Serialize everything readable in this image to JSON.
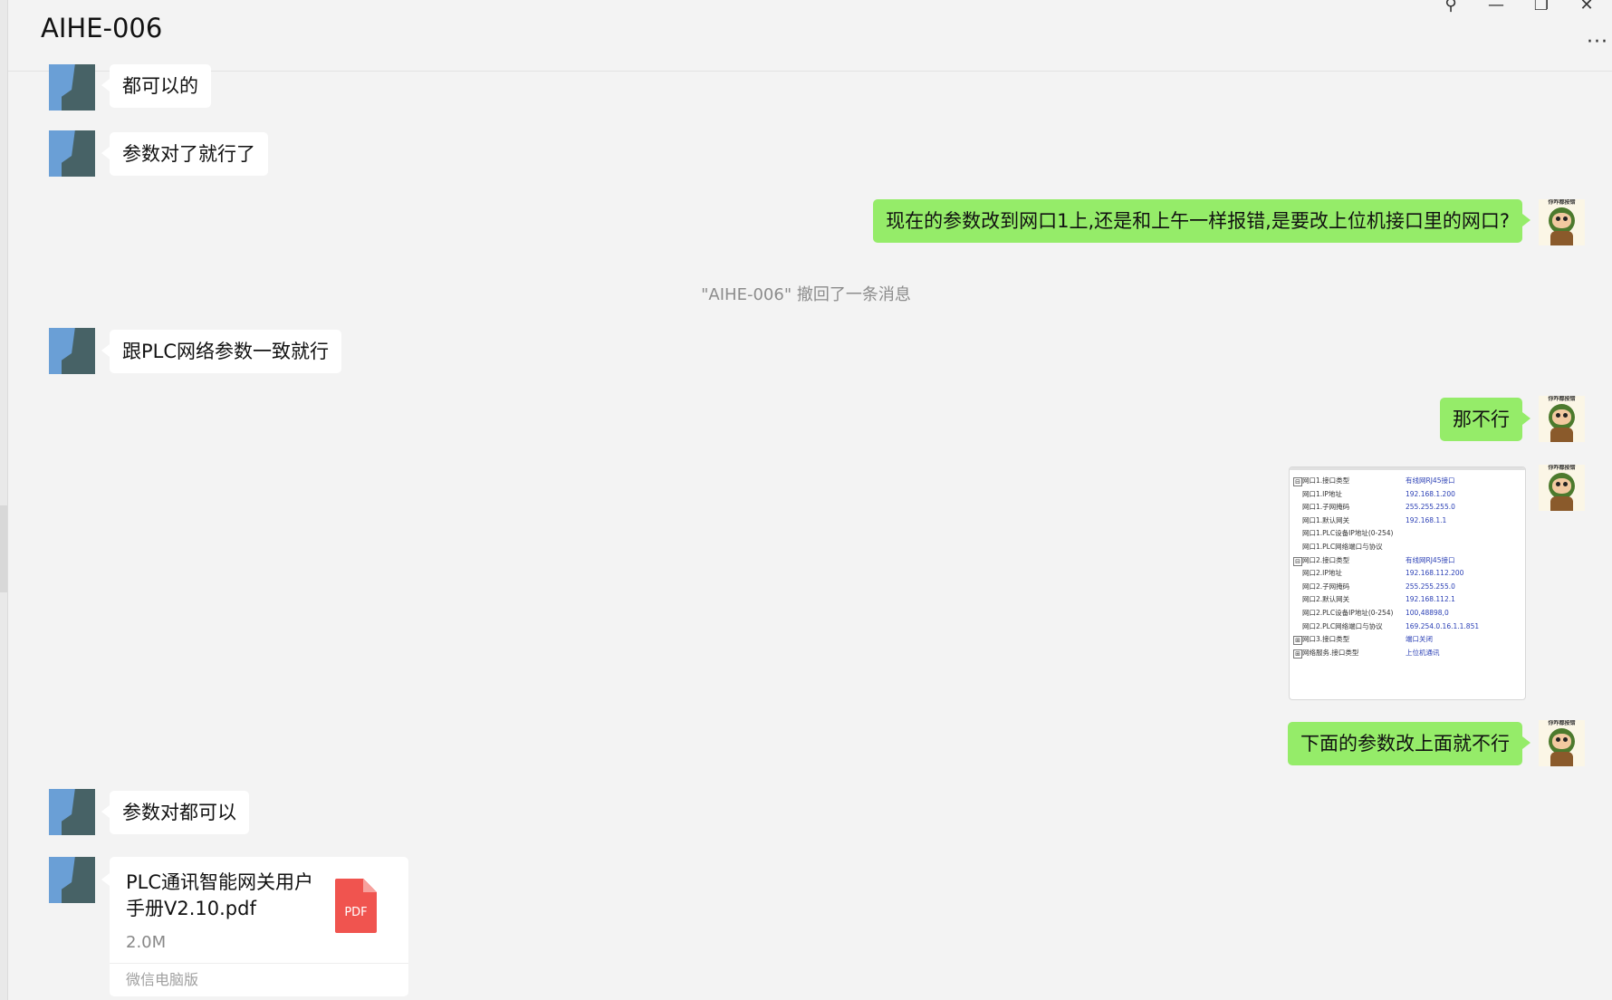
{
  "header": {
    "title": "AIHE-006",
    "more_label": "···"
  },
  "window_controls": {
    "pin": "⚲",
    "minimize": "—",
    "restore": "❐",
    "close": "✕"
  },
  "messages": {
    "m1": "都可以的",
    "m2": "参数对了就行了",
    "m3": "现在的参数改到网口1上,还是和上午一样报错,是要改上位机接口里的网口?",
    "recall": "\"AIHE-006\" 撤回了一条消息",
    "m4": "跟PLC网络参数一致就行",
    "m5": "那不行",
    "m6": "下面的参数改上面就不行",
    "m7": "参数对都可以"
  },
  "my_avatar_caption": "你咋都按错",
  "screenshot_rows": [
    {
      "toggle": "⊟",
      "key": "网口1.接口类型",
      "value": "有线网RJ45接口"
    },
    {
      "toggle": "",
      "key": "网口1.IP地址",
      "value": "192.168.1.200"
    },
    {
      "toggle": "",
      "key": "网口1.子网掩码",
      "value": "255.255.255.0"
    },
    {
      "toggle": "",
      "key": "网口1.默认网关",
      "value": "192.168.1.1"
    },
    {
      "toggle": "",
      "key": "网口1.PLC设备IP地址(0-254)",
      "value": ""
    },
    {
      "toggle": "",
      "key": "网口1.PLC网络端口与协议",
      "value": ""
    },
    {
      "toggle": "⊟",
      "key": "网口2.接口类型",
      "value": "有线网RJ45接口"
    },
    {
      "toggle": "",
      "key": "网口2.IP地址",
      "value": "192.168.112.200"
    },
    {
      "toggle": "",
      "key": "网口2.子网掩码",
      "value": "255.255.255.0"
    },
    {
      "toggle": "",
      "key": "网口2.默认网关",
      "value": "192.168.112.1"
    },
    {
      "toggle": "",
      "key": "网口2.PLC设备IP地址(0-254)",
      "value": "100,48898,0"
    },
    {
      "toggle": "",
      "key": "网口2.PLC网络端口与协议",
      "value": "169.254.0.16.1.1.851"
    },
    {
      "toggle": "⊞",
      "key": "网口3.接口类型",
      "value": "端口关闭"
    },
    {
      "toggle": "⊞",
      "key": "网络服务.接口类型",
      "value": "上位机通讯"
    }
  ],
  "file": {
    "name": "PLC通讯智能网关用户手册V2.10.pdf",
    "size": "2.0M",
    "icon_label": "PDF",
    "source": "微信电脑版"
  }
}
